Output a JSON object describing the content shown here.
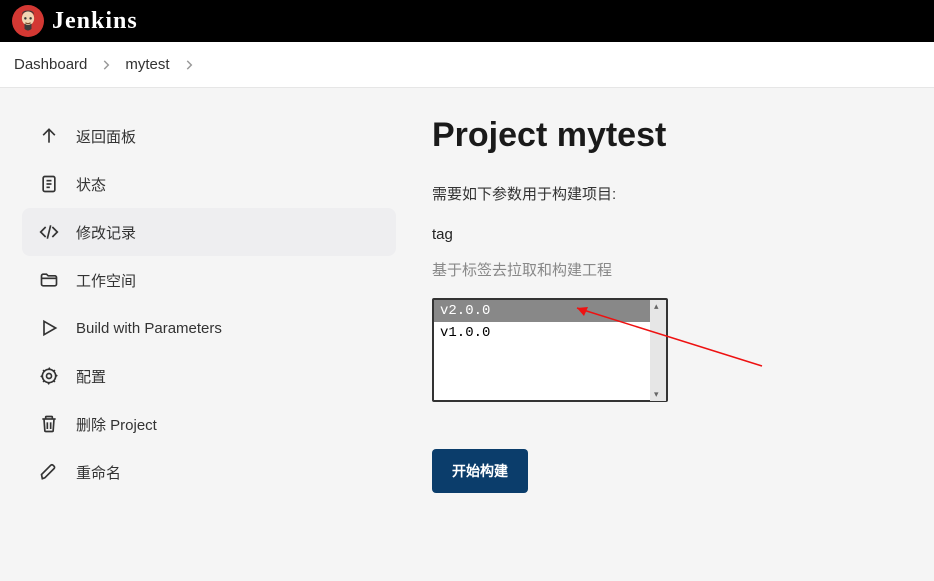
{
  "header": {
    "brand": "Jenkins"
  },
  "breadcrumb": {
    "items": [
      "Dashboard",
      "mytest"
    ]
  },
  "sidebar": {
    "items": [
      {
        "label": "返回面板"
      },
      {
        "label": "状态"
      },
      {
        "label": "修改记录"
      },
      {
        "label": "工作空间"
      },
      {
        "label": "Build with Parameters"
      },
      {
        "label": "配置"
      },
      {
        "label": "删除 Project"
      },
      {
        "label": "重命名"
      }
    ]
  },
  "main": {
    "title": "Project mytest",
    "param_intro": "需要如下参数用于构建项目:",
    "param_name": "tag",
    "param_desc": "基于标签去拉取和构建工程",
    "tag_options": [
      "v2.0.0",
      "v1.0.0"
    ],
    "selected_tag": "v2.0.0",
    "build_button": "开始构建"
  },
  "colors": {
    "primary": "#0b3d6b"
  }
}
